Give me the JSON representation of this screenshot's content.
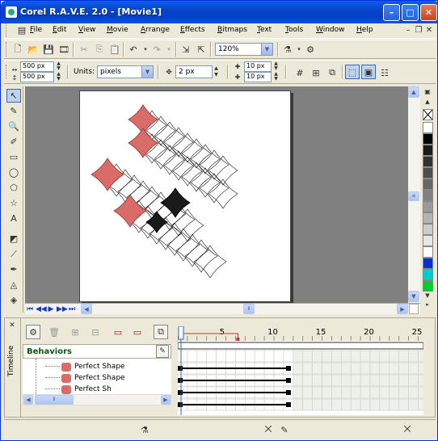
{
  "window": {
    "title": "Corel R.A.V.E. 2.0 - [Movie1]",
    "minimize_symbol": "–",
    "maximize_symbol": "□",
    "close_symbol": "✕"
  },
  "menubar": {
    "items": [
      {
        "underline": "F",
        "rest": "ile"
      },
      {
        "underline": "E",
        "rest": "dit"
      },
      {
        "underline": "V",
        "rest": "iew"
      },
      {
        "underline": "M",
        "rest": "ovie"
      },
      {
        "underline": "A",
        "rest": "rrange"
      },
      {
        "underline": "E",
        "rest": "ffects"
      },
      {
        "underline": "B",
        "rest": "itmaps"
      },
      {
        "underline": "T",
        "rest": "ext"
      },
      {
        "underline": "T",
        "rest": "ools"
      },
      {
        "underline": "W",
        "rest": "indow"
      },
      {
        "underline": "H",
        "rest": "elp"
      }
    ]
  },
  "standard_toolbar": {
    "zoom_value": "120%"
  },
  "property_bar": {
    "width_value": "500 px",
    "height_value": "500 px",
    "units_label": "Units:",
    "units_value": "pixels",
    "nudge_value": "2 px",
    "dup_x_value": "10 px",
    "dup_y_value": "10 px"
  },
  "timeline": {
    "panel_label": "Timeline",
    "behaviors_label": "Behaviors",
    "ruler_ticks": [
      "5",
      "10",
      "15",
      "20",
      "25"
    ],
    "current_frame": 1,
    "tree_items": [
      "Perfect Shape",
      "Perfect Shape",
      "Perfect Sh"
    ]
  },
  "palette": {
    "colors": [
      "#ffffff",
      "#000000",
      "#1a1a1a",
      "#333333",
      "#4d4d4d",
      "#666666",
      "#808080",
      "#999999",
      "#b3b3b3",
      "#cccccc",
      "#e6e6e6",
      "#ffffff",
      "#0033cc",
      "#00cccc",
      "#00cc33"
    ]
  },
  "colors": {
    "shape_fill": "#d96b68",
    "shape_dark": "#1a1a1a",
    "accent": "#0a44c8",
    "playhead": "#c0392b"
  }
}
